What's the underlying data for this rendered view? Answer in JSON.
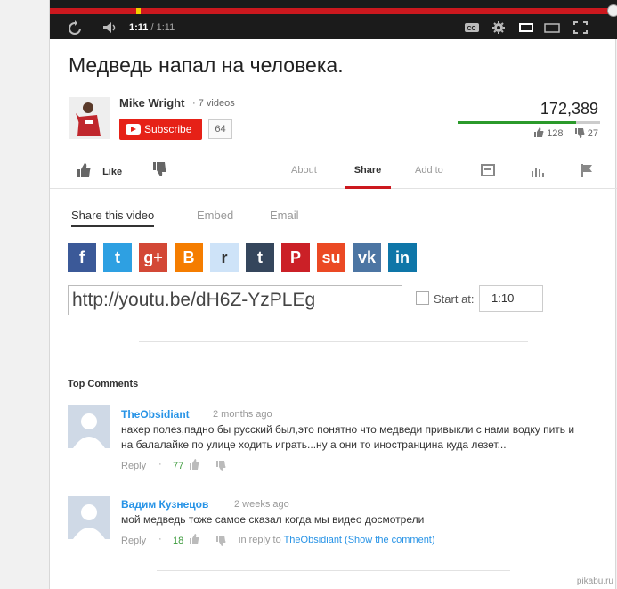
{
  "player": {
    "current_time": "1:11",
    "separator": "/",
    "duration": "1:11",
    "played_fraction": 1.0,
    "icons": [
      "replay-icon",
      "volume-icon",
      "captions-icon",
      "settings-icon",
      "small-player-icon",
      "large-player-icon",
      "fullscreen-icon"
    ]
  },
  "video": {
    "title": "Медведь напал на человека.",
    "channel": "Mike Wright",
    "video_count": "7 videos",
    "subscribe_label": "Subscribe",
    "subscriber_count": "64",
    "views": "172,389",
    "likes": "128",
    "dislikes": "27",
    "like_ratio": 0.83
  },
  "actions": {
    "like_label": "Like",
    "tabs": [
      "About",
      "Share",
      "Add to"
    ],
    "active_tab": "Share"
  },
  "share": {
    "tabs": [
      "Share this video",
      "Embed",
      "Email"
    ],
    "services": [
      {
        "name": "facebook",
        "glyph": "f",
        "color": "#3b5998"
      },
      {
        "name": "twitter",
        "glyph": "t",
        "color": "#2ea0e2"
      },
      {
        "name": "google-plus",
        "glyph": "g+",
        "color": "#d34836"
      },
      {
        "name": "blogger",
        "glyph": "B",
        "color": "#f57d00"
      },
      {
        "name": "reddit",
        "glyph": "r",
        "color": "#cee3f8"
      },
      {
        "name": "tumblr",
        "glyph": "t",
        "color": "#35465c"
      },
      {
        "name": "pinterest",
        "glyph": "P",
        "color": "#cb2027"
      },
      {
        "name": "stumbleupon",
        "glyph": "su",
        "color": "#eb4924"
      },
      {
        "name": "vk",
        "glyph": "vk",
        "color": "#4c75a3"
      },
      {
        "name": "linkedin",
        "glyph": "in",
        "color": "#0e76a8"
      }
    ],
    "url": "http://youtu.be/dH6Z-YzPLEg",
    "start_at_label": "Start at:",
    "start_at_value": "1:10"
  },
  "comments": {
    "heading": "Top Comments",
    "items": [
      {
        "author": "TheObsidiant",
        "date": "2 months ago",
        "text": "нахер полез,падно бы русский был,это понятно что медведи привыкли с нами водку пить и на балалайке по улице ходить играть...ну а они то иностранцина куда лезет...",
        "reply_label": "Reply",
        "score": "77"
      },
      {
        "author": "Вадим Кузнецов",
        "date": "2 weeks ago",
        "text": "мой медведь тоже самое сказал когда мы видео досмотрели",
        "reply_label": "Reply",
        "score": "18",
        "in_reply_prefix": "in reply to",
        "in_reply_link": "TheObsidiant (Show the comment)"
      }
    ]
  },
  "watermark": "pikabu.ru"
}
